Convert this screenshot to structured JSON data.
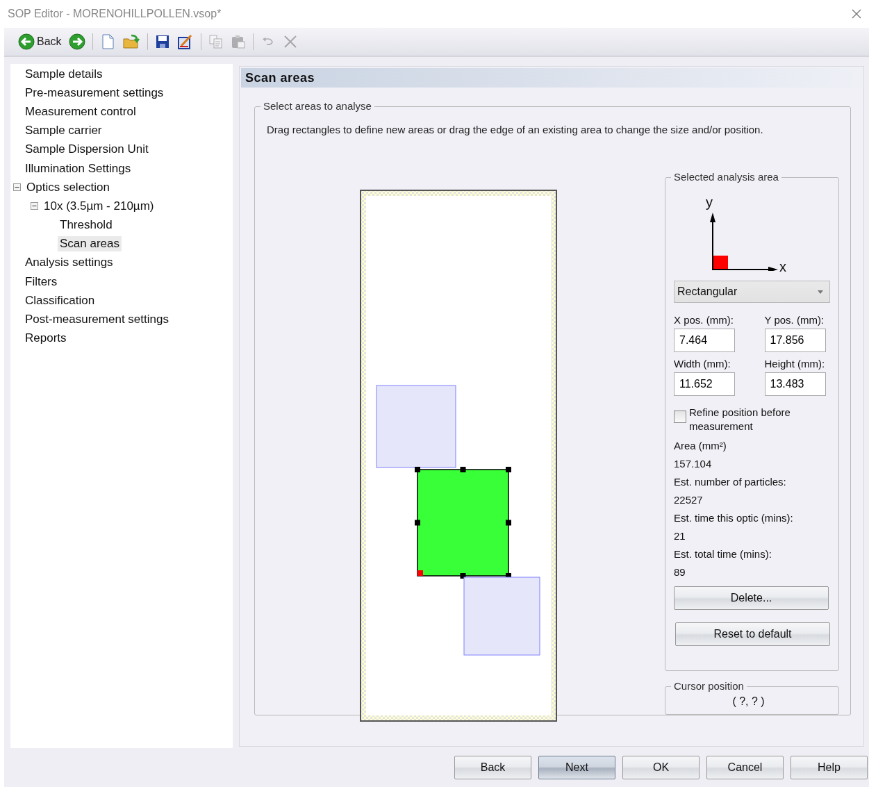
{
  "window": {
    "title": "SOP Editor - MORENOHILLPOLLEN.vsop*"
  },
  "toolbar": [
    {
      "kind": "back",
      "label": "Back",
      "disabled": false
    },
    {
      "kind": "forward",
      "disabled": false
    },
    {
      "kind": "separator"
    },
    {
      "kind": "new",
      "disabled": false
    },
    {
      "kind": "open",
      "disabled": false
    },
    {
      "kind": "separator"
    },
    {
      "kind": "save",
      "disabled": false
    },
    {
      "kind": "edit",
      "disabled": false
    },
    {
      "kind": "separator"
    },
    {
      "kind": "copy",
      "disabled": true
    },
    {
      "kind": "paste",
      "disabled": true
    },
    {
      "kind": "separator"
    },
    {
      "kind": "undo",
      "disabled": true
    },
    {
      "kind": "delete",
      "disabled": true
    }
  ],
  "tree": [
    {
      "label": "Sample details",
      "selected": false
    },
    {
      "label": "Pre-measurement settings",
      "selected": false
    },
    {
      "label": "Measurement control",
      "selected": false
    },
    {
      "label": "Sample carrier",
      "selected": false
    },
    {
      "label": "Sample Dispersion Unit",
      "selected": false
    },
    {
      "label": "Illumination Settings",
      "selected": false
    },
    {
      "label": "Optics selection",
      "selected": false,
      "expanded": true,
      "children": [
        {
          "label": "10x (3.5µm - 210µm)",
          "selected": false,
          "expanded": true,
          "children": [
            {
              "label": "Threshold",
              "selected": false
            },
            {
              "label": "Scan areas",
              "selected": true
            }
          ]
        }
      ]
    },
    {
      "label": "Analysis settings",
      "selected": false
    },
    {
      "label": "Filters",
      "selected": false
    },
    {
      "label": "Classification",
      "selected": false
    },
    {
      "label": "Post-measurement settings",
      "selected": false
    },
    {
      "label": "Reports",
      "selected": false
    }
  ],
  "panel": {
    "title": "Scan areas",
    "group_title": "Select areas to analyse",
    "instructions": "Drag rectangles to define new areas or drag the edge of an existing area to change the size and/or position.",
    "areas": [
      {
        "selected": false
      },
      {
        "selected": true
      },
      {
        "selected": false
      }
    ],
    "selected_area": {
      "title": "Selected analysis area",
      "axis_y": "y",
      "axis_x": "x",
      "shape": "Rectangular",
      "fields": [
        {
          "label": "X pos. (mm):",
          "value": "7.464"
        },
        {
          "label": "Y pos. (mm):",
          "value": "17.856"
        },
        {
          "label": "Width (mm):",
          "value": "11.652"
        },
        {
          "label": "Height (mm):",
          "value": "13.483"
        }
      ],
      "refine": {
        "label": "Refine position before measurement",
        "checked": false
      },
      "stats": [
        {
          "label": "Area (mm²)",
          "value": "157.104"
        },
        {
          "label": "Est. number of particles:",
          "value": "22527"
        },
        {
          "label": "Est. time this optic (mins):",
          "value": "21"
        },
        {
          "label": "Est. total time (mins):",
          "value": "89"
        }
      ],
      "buttons": [
        "Delete...",
        "Reset to default"
      ]
    },
    "cursor": {
      "title": "Cursor position",
      "value": "( ?, ? )"
    }
  },
  "footer_buttons": [
    {
      "label": "Back",
      "selected": false
    },
    {
      "label": "Next",
      "selected": true
    },
    {
      "label": "OK",
      "selected": false
    },
    {
      "label": "Cancel",
      "selected": false
    },
    {
      "label": "Help",
      "selected": false
    }
  ]
}
